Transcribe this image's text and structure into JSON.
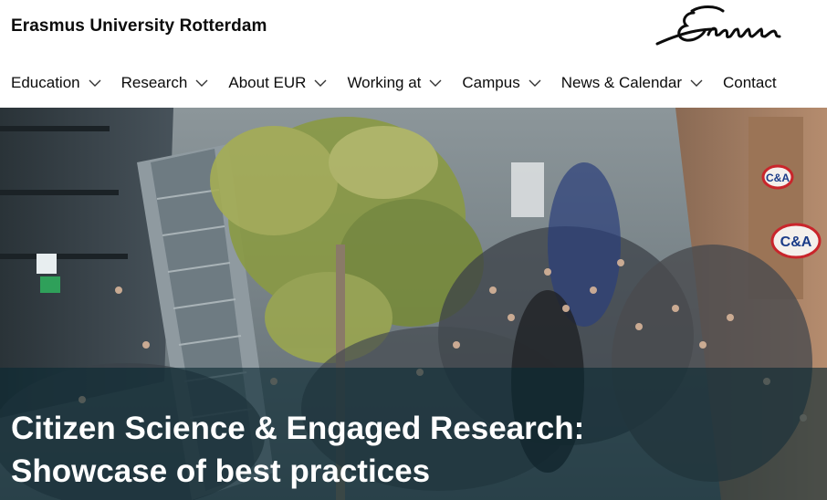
{
  "header": {
    "site_name": "Erasmus University Rotterdam",
    "logo_text": "Erasmus"
  },
  "nav": {
    "items": [
      {
        "label": "Education",
        "has_dropdown": true
      },
      {
        "label": "Research",
        "has_dropdown": true
      },
      {
        "label": "About EUR",
        "has_dropdown": true
      },
      {
        "label": "Working at",
        "has_dropdown": true
      },
      {
        "label": "Campus",
        "has_dropdown": true
      },
      {
        "label": "News & Calendar",
        "has_dropdown": true
      },
      {
        "label": "Contact",
        "has_dropdown": false
      }
    ]
  },
  "hero": {
    "title_line1": "Citizen Science & Engaged Research:",
    "title_line2": "Showcase of best practices",
    "image_subject": "academic procession through shopping street",
    "sign_text_1": "C&A",
    "sign_text_2": "C&A"
  },
  "colors": {
    "text": "#0c0c0c",
    "overlay": "#0a2832",
    "title": "#ffffff"
  }
}
